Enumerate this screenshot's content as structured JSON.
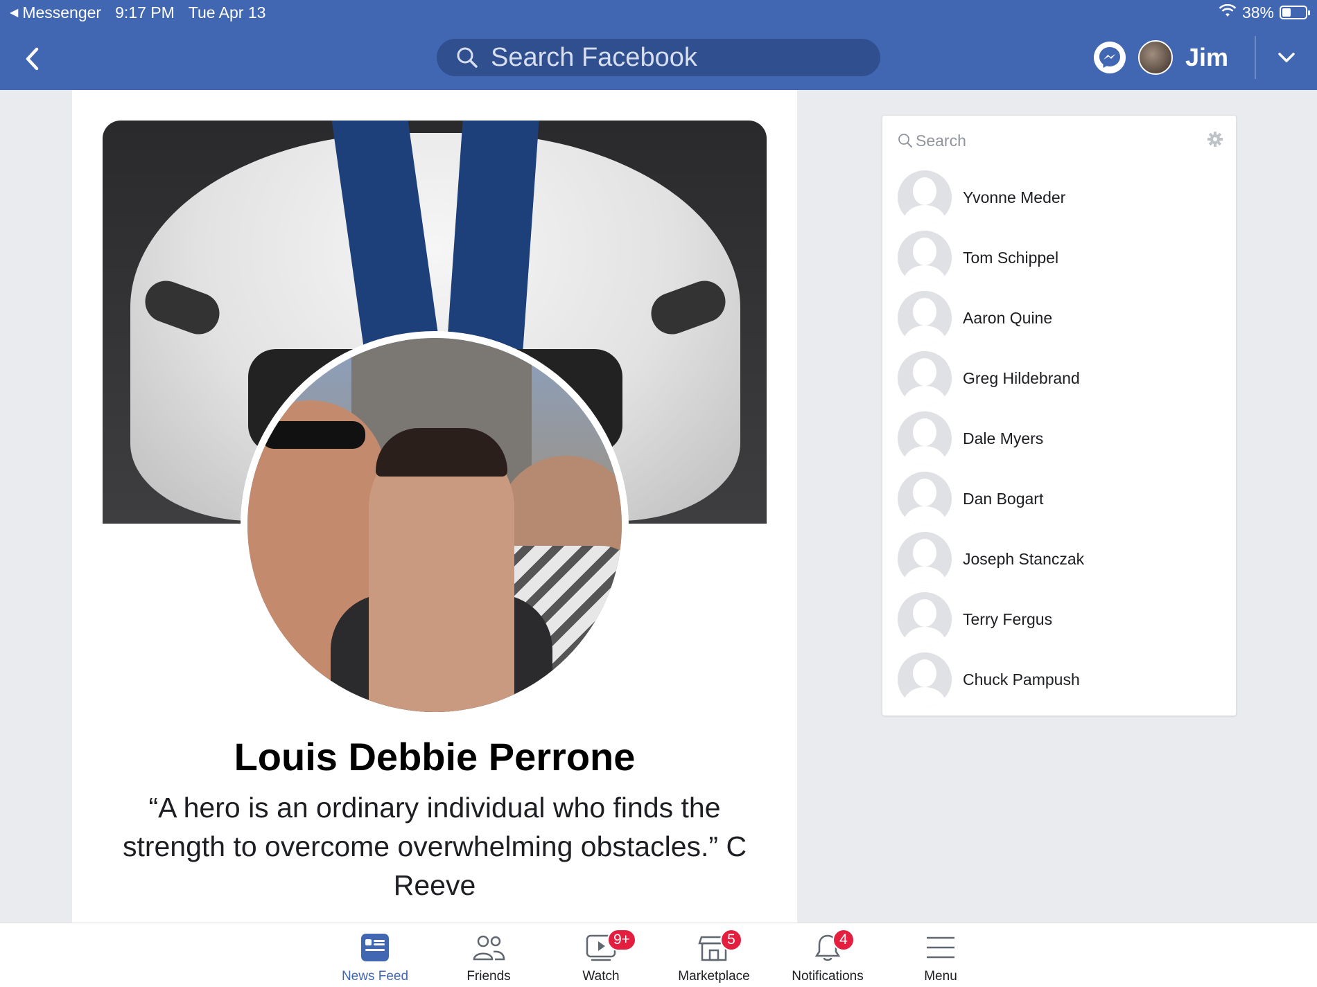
{
  "status_bar": {
    "back_app": "Messenger",
    "time": "9:17 PM",
    "date": "Tue Apr 13",
    "battery": "38%",
    "battery_level": 0.38
  },
  "header": {
    "search_placeholder": "Search Facebook",
    "user_name": "Jim"
  },
  "profile": {
    "name": "Louis Debbie Perrone",
    "bio": "“A hero is an ordinary individual who finds the strength to overcome overwhelming obstacles.” C Reeve"
  },
  "contacts": {
    "search_placeholder": "Search",
    "items": [
      {
        "name": "Yvonne Meder"
      },
      {
        "name": "Tom Schippel"
      },
      {
        "name": "Aaron Quine"
      },
      {
        "name": "Greg Hildebrand"
      },
      {
        "name": "Dale Myers"
      },
      {
        "name": "Dan Bogart"
      },
      {
        "name": "Joseph Stanczak"
      },
      {
        "name": "Terry Fergus"
      },
      {
        "name": "Chuck Pampush"
      }
    ]
  },
  "tabbar": {
    "tabs": [
      {
        "label": "News Feed",
        "icon": "news-feed-icon",
        "active": true
      },
      {
        "label": "Friends",
        "icon": "friends-icon"
      },
      {
        "label": "Watch",
        "icon": "watch-icon",
        "badge": "9+"
      },
      {
        "label": "Marketplace",
        "icon": "marketplace-icon",
        "badge": "5"
      },
      {
        "label": "Notifications",
        "icon": "bell-icon",
        "badge": "4"
      },
      {
        "label": "Menu",
        "icon": "menu-icon"
      }
    ]
  },
  "colors": {
    "brand": "#4267b2",
    "badge": "#e41e3f"
  }
}
